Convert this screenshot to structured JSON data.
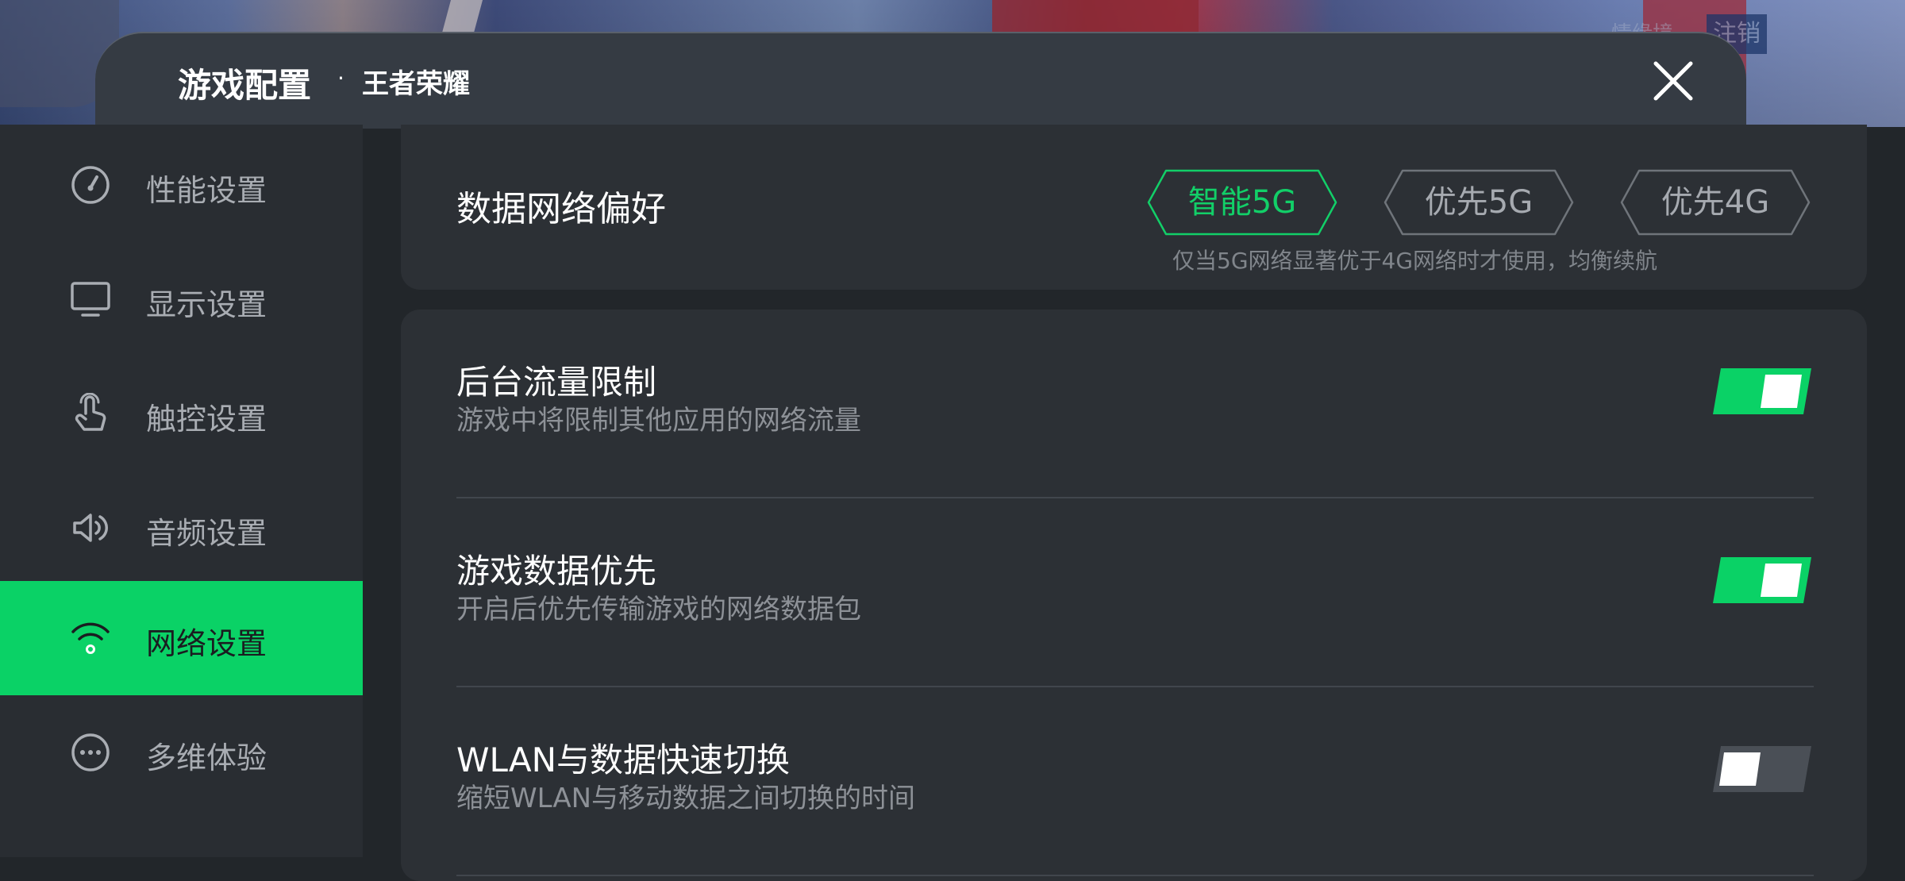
{
  "header": {
    "title": "游戏配置",
    "separator": "·",
    "game_name": "王者荣耀"
  },
  "background": {
    "logout_label": "注销",
    "faded_label": "情缘境"
  },
  "sidebar": {
    "items": [
      {
        "label": "性能设置",
        "icon": "speedometer-icon",
        "active": false
      },
      {
        "label": "显示设置",
        "icon": "monitor-icon",
        "active": false
      },
      {
        "label": "触控设置",
        "icon": "touch-hand-icon",
        "active": false
      },
      {
        "label": "音频设置",
        "icon": "speaker-icon",
        "active": false
      },
      {
        "label": "网络设置",
        "icon": "wifi-icon",
        "active": true
      },
      {
        "label": "多维体验",
        "icon": "more-dots-icon",
        "active": false
      }
    ]
  },
  "network_preference": {
    "label": "数据网络偏好",
    "options": [
      {
        "label": "智能5G",
        "selected": true
      },
      {
        "label": "优先5G",
        "selected": false
      },
      {
        "label": "优先4G",
        "selected": false
      }
    ],
    "hint": "仅当5G网络显著优于4G网络时才使用，均衡续航"
  },
  "settings": [
    {
      "title": "后台流量限制",
      "description": "游戏中将限制其他应用的网络流量",
      "enabled": true
    },
    {
      "title": "游戏数据优先",
      "description": "开启后优先传输游戏的网络数据包",
      "enabled": true
    },
    {
      "title": "WLAN与数据快速切换",
      "description": "缩短WLAN与移动数据之间切换的时间",
      "enabled": false
    }
  ],
  "colors": {
    "accent": "#0ad266",
    "panel": "#2c3035",
    "sidebar": "#292d32",
    "header": "#353b43",
    "toggle_off": "#4a4f56"
  }
}
